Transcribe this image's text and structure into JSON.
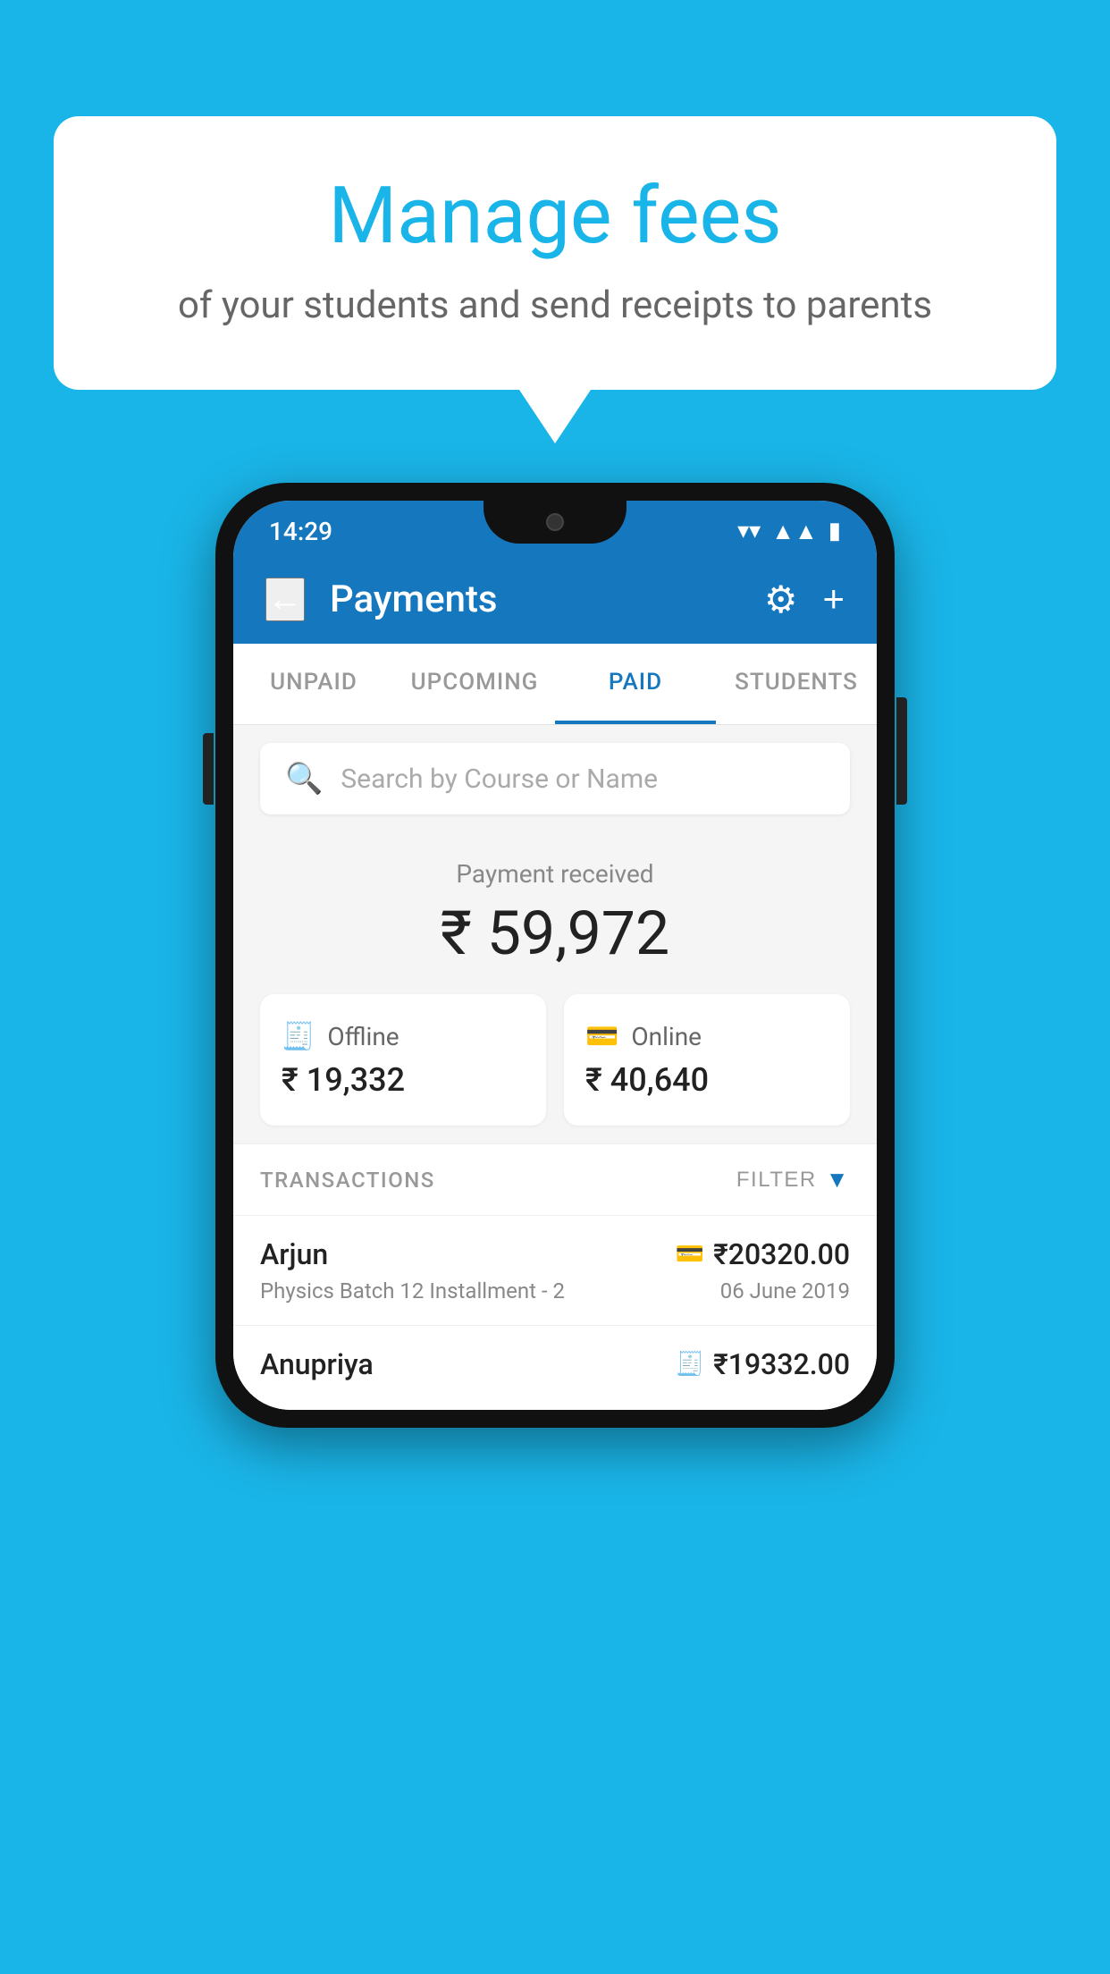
{
  "background_color": "#1ab5e8",
  "bubble": {
    "title": "Manage fees",
    "subtitle": "of your students and send receipts to parents"
  },
  "status_bar": {
    "time": "14:29",
    "icons": [
      "wifi",
      "signal",
      "battery"
    ]
  },
  "header": {
    "title": "Payments",
    "back_label": "←",
    "gear_label": "⚙",
    "plus_label": "+"
  },
  "tabs": [
    {
      "id": "unpaid",
      "label": "UNPAID",
      "active": false
    },
    {
      "id": "upcoming",
      "label": "UPCOMING",
      "active": false
    },
    {
      "id": "paid",
      "label": "PAID",
      "active": true
    },
    {
      "id": "students",
      "label": "STUDENTS",
      "active": false
    }
  ],
  "search": {
    "placeholder": "Search by Course or Name"
  },
  "payment_summary": {
    "received_label": "Payment received",
    "total_amount": "₹ 59,972",
    "offline": {
      "icon": "💳",
      "label": "Offline",
      "amount": "₹ 19,332"
    },
    "online": {
      "icon": "💳",
      "label": "Online",
      "amount": "₹ 40,640"
    }
  },
  "transactions": {
    "section_label": "TRANSACTIONS",
    "filter_label": "FILTER",
    "rows": [
      {
        "name": "Arjun",
        "course": "Physics Batch 12 Installment - 2",
        "date": "06 June 2019",
        "amount": "₹20320.00",
        "payment_type": "online"
      },
      {
        "name": "Anupriya",
        "course": "",
        "date": "",
        "amount": "₹19332.00",
        "payment_type": "offline"
      }
    ]
  }
}
